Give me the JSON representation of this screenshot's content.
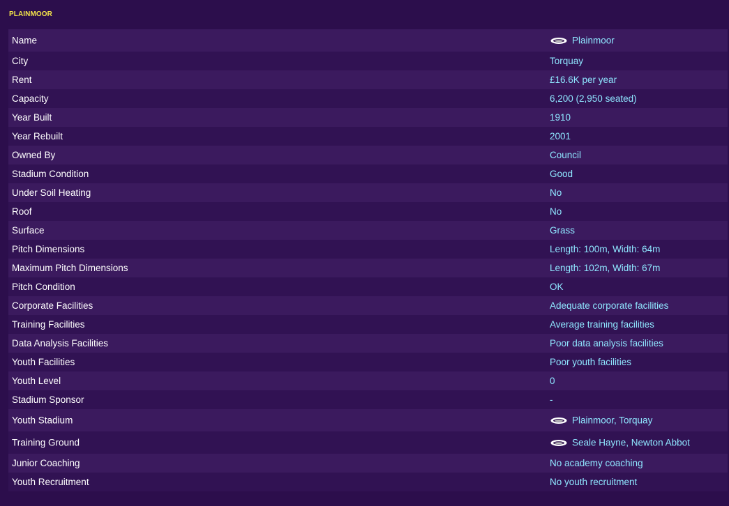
{
  "panel": {
    "title": "PLAINMOOR"
  },
  "rows": [
    {
      "label": "Name",
      "value": "Plainmoor",
      "icon": "stadium-icon"
    },
    {
      "label": "City",
      "value": "Torquay"
    },
    {
      "label": "Rent",
      "value": "£16.6K per year"
    },
    {
      "label": "Capacity",
      "value": "6,200 (2,950 seated)"
    },
    {
      "label": "Year Built",
      "value": "1910"
    },
    {
      "label": "Year Rebuilt",
      "value": "2001"
    },
    {
      "label": "Owned By",
      "value": "Council"
    },
    {
      "label": "Stadium Condition",
      "value": "Good"
    },
    {
      "label": "Under Soil Heating",
      "value": "No"
    },
    {
      "label": "Roof",
      "value": "No"
    },
    {
      "label": "Surface",
      "value": "Grass"
    },
    {
      "label": "Pitch Dimensions",
      "value": "Length: 100m, Width: 64m"
    },
    {
      "label": "Maximum Pitch Dimensions",
      "value": "Length: 102m, Width: 67m"
    },
    {
      "label": "Pitch Condition",
      "value": "OK"
    },
    {
      "label": "Corporate Facilities",
      "value": "Adequate corporate facilities"
    },
    {
      "label": "Training Facilities",
      "value": "Average training facilities"
    },
    {
      "label": "Data Analysis Facilities",
      "value": "Poor data analysis facilities"
    },
    {
      "label": "Youth Facilities",
      "value": "Poor youth facilities"
    },
    {
      "label": "Youth Level",
      "value": "0"
    },
    {
      "label": "Stadium Sponsor",
      "value": "-"
    },
    {
      "label": "Youth Stadium",
      "value": "Plainmoor, Torquay",
      "icon": "stadium-icon"
    },
    {
      "label": "Training Ground",
      "value": "Seale Hayne, Newton Abbot",
      "icon": "stadium-icon"
    },
    {
      "label": "Junior Coaching",
      "value": "No academy coaching"
    },
    {
      "label": "Youth Recruitment",
      "value": "No youth recruitment"
    }
  ],
  "colors": {
    "background": "#2c0e4c",
    "row_light": "#3b1a5e",
    "row_dark": "#311253",
    "title": "#f2e24a",
    "label": "#ffffff",
    "value": "#8fe6ff"
  }
}
